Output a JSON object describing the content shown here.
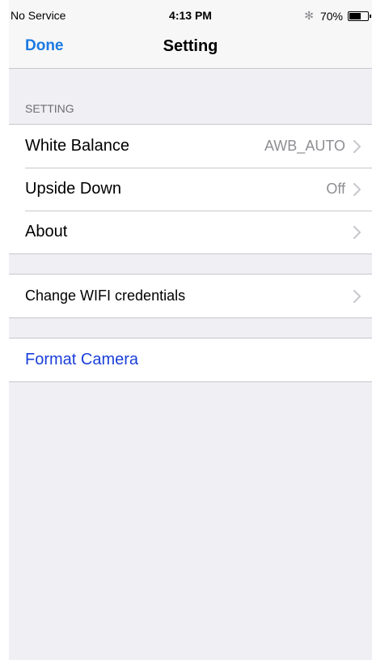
{
  "status_bar": {
    "carrier": "No Service",
    "time": "4:13 PM",
    "bluetooth_glyph": "✻",
    "battery_percent": "70%",
    "battery_level": 0.7
  },
  "nav": {
    "done_label": "Done",
    "title": "Setting"
  },
  "section": {
    "header": "SETTING",
    "rows": [
      {
        "label": "White Balance",
        "value": "AWB_AUTO"
      },
      {
        "label": "Upside Down",
        "value": "Off"
      },
      {
        "label": "About",
        "value": ""
      }
    ]
  },
  "wifi": {
    "label": "Change WIFI credentials"
  },
  "format": {
    "label": "Format Camera",
    "color": "#1a3fd9"
  },
  "colors": {
    "accent": "#1a7ae2",
    "background": "#efeff4",
    "secondary_text": "#8e8e93"
  },
  "icons": {
    "chevron": "chevron-right-icon",
    "bluetooth": "bluetooth-icon",
    "battery": "battery-icon"
  }
}
